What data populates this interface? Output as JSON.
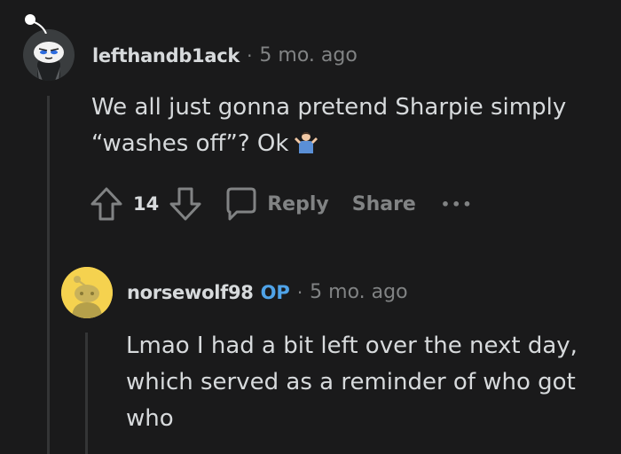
{
  "comments": [
    {
      "username": "lefthandb1ack",
      "separator": "·",
      "time": "5 mo. ago",
      "body": "We all just gonna pretend Sharpie simply\n“washes off”? Ok",
      "emoji_icon": "person-shrugging-icon",
      "votes": "14",
      "actions": {
        "reply": "Reply",
        "share": "Share",
        "more": "•••"
      }
    },
    {
      "username": "norsewolf98",
      "op_badge": "OP",
      "separator": "·",
      "time": "5 mo. ago",
      "body": "Lmao I had a bit left over the next day,\nwhich served as a reminder of who got\nwho"
    }
  ],
  "colors": {
    "background": "#1a1a1b",
    "text": "#d7dadc",
    "muted": "#818384",
    "op": "#4fa3e8",
    "thread_line": "#343536",
    "avatar2_bg": "#f5d24f"
  }
}
